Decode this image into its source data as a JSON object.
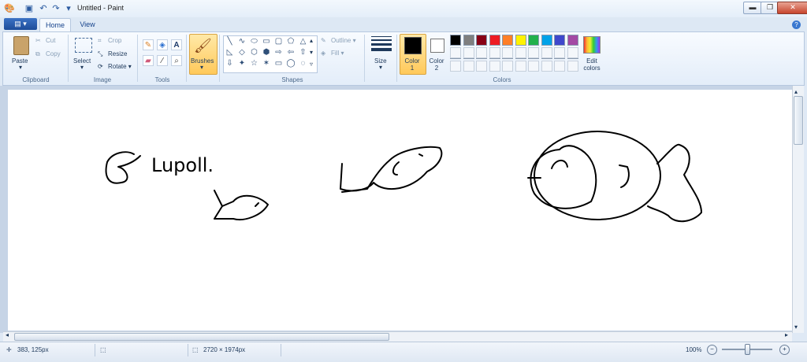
{
  "window": {
    "title": "Untitled - Paint",
    "controls": {
      "minimize": "▬",
      "maximize": "❐",
      "close": "✕"
    }
  },
  "ribbon_tabs": {
    "file": "▤ ▾",
    "home": "Home",
    "view": "View",
    "help": "?"
  },
  "clipboard": {
    "paste": "Paste",
    "cut": "Cut",
    "copy": "Copy",
    "group": "Clipboard"
  },
  "image": {
    "select": "Select",
    "crop": "Crop",
    "resize": "Resize",
    "rotate": "Rotate ▾",
    "group": "Image"
  },
  "tools": {
    "group": "Tools",
    "text_tool": "A"
  },
  "brushes": {
    "label": "Brushes"
  },
  "shapes": {
    "outline": "Outline ▾",
    "fill": "Fill ▾",
    "group": "Shapes",
    "glyphs": [
      "╲",
      "∿",
      "⬭",
      "▭",
      "▢",
      "⬠",
      "△",
      "◺",
      "◇",
      "⬡",
      "⬢",
      "⇨",
      "⇦",
      "⇧",
      "⇩",
      "✦",
      "☆",
      "✶",
      "▭",
      "◯",
      "◌"
    ]
  },
  "size": {
    "label": "Size"
  },
  "colors": {
    "color1": "Color 1",
    "color2": "Color 2",
    "edit": "Edit colors",
    "group": "Colors",
    "color1_value": "#000000",
    "color2_value": "#ffffff",
    "palette_row1": [
      "#000000",
      "#7f7f7f",
      "#880015",
      "#ed1c24",
      "#ff7f27",
      "#fff200",
      "#22b14c",
      "#00a2e8",
      "#3f48cc",
      "#a349a4"
    ],
    "palette_row2": [
      "#ffffff",
      "#c3c3c3",
      "#b97a57",
      "#ffaec9",
      "#ffc90e",
      "#efe4b0",
      "#b5e61d",
      "#99d9ea",
      "#7092be",
      "#c8bfe7"
    ]
  },
  "drawing": {
    "handwriting": "Lupoll."
  },
  "status": {
    "cursor_pos": "383, 125px",
    "image_size": "2720 × 1974px",
    "zoom": "100%",
    "zoom_level": 1.0
  }
}
